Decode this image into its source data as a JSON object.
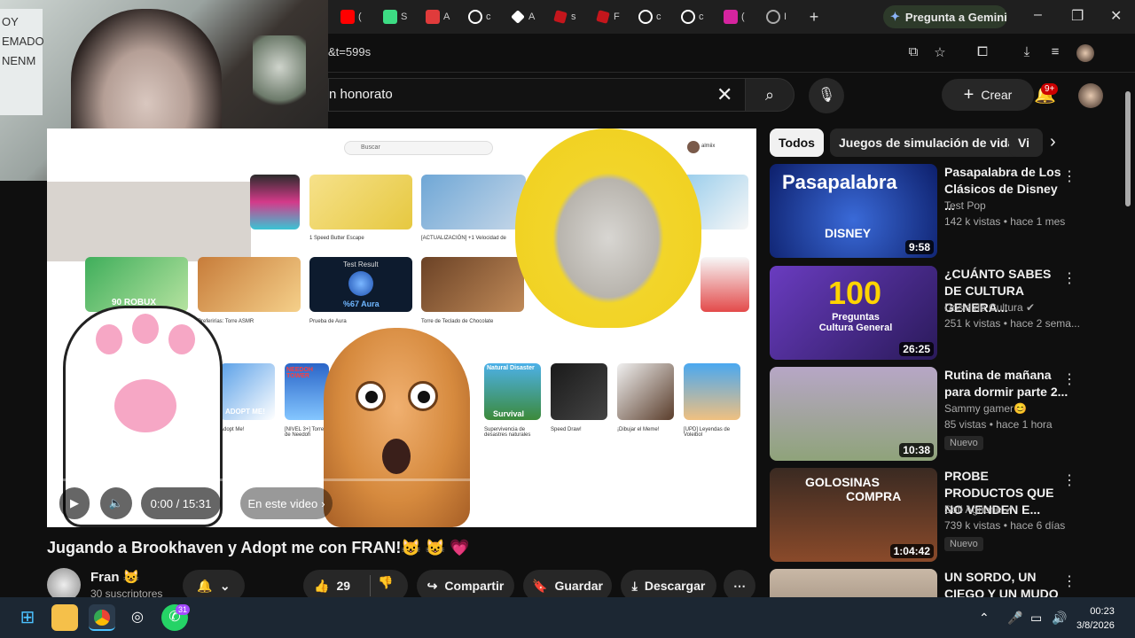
{
  "browser": {
    "url_fragment": "&t=599s",
    "tabs": [
      {
        "label": "(",
        "icon": "youtube-icon",
        "color": "#ff0000"
      },
      {
        "label": "S",
        "icon": "k-icon",
        "color": "#3ddc84"
      },
      {
        "label": "A",
        "icon": "pdf-icon",
        "color": "#e03b3b"
      },
      {
        "label": "c",
        "icon": "google-icon",
        "color": "#ffffff"
      },
      {
        "label": "A",
        "icon": "diamond-icon",
        "color": "#ffffff"
      },
      {
        "label": "s",
        "icon": "roblox-icon",
        "color": "#c4161c"
      },
      {
        "label": "F",
        "icon": "roblox-icon",
        "color": "#c4161c"
      },
      {
        "label": "c",
        "icon": "google-icon",
        "color": "#ffffff"
      },
      {
        "label": "c",
        "icon": "google-icon",
        "color": "#ffffff"
      },
      {
        "label": "(",
        "icon": "instagram-icon",
        "color": "#d6249f"
      },
      {
        "label": "I",
        "icon": "chrome-icon",
        "color": "#aaaaaa"
      }
    ],
    "gemini_label": "Pregunta a Gemini"
  },
  "webcam": {
    "paper_text": [
      "OY",
      "EMADO",
      "NENM"
    ]
  },
  "youtube": {
    "search_value": "n honorato",
    "create_label": "Crear",
    "notif_badge": "9+",
    "video": {
      "title": "Jugando a Brookhaven y Adopt me con FRAN!😺 😺 💗",
      "time": "0:00 / 15:31",
      "chapters_label": "En este video",
      "inner_search_placeholder": "Buscar",
      "inner_user": "almiix",
      "inner_captions": [
        "1 Speed Butter Escape",
        "[ACTUALIZACIÓN] +1 Velocidad de",
        "Preferirías: Torre ASMR",
        "Prueba de Aura",
        "Torre de Teclado de Chocolate",
        "Adopt Me!",
        "[NIVEL 3+] Torre de Needoh",
        "Supervivencia de desastres naturales",
        "Speed Draw!",
        "¡Dibujar el Meme!",
        "[UPD] Leyendas de Voleibol"
      ],
      "inner_labels": {
        "test_result": "Test Result",
        "aura": "%67 Aura",
        "adopt": "ADOPT ME!",
        "natural_disaster": "Natural Disaster",
        "survival": "Survival",
        "needoh": "NEEDOH TOWER",
        "robux": "90 ROBUX"
      }
    },
    "channel": {
      "name": "Fran 😺",
      "subscribers": "30 suscriptores"
    },
    "actions": {
      "likes": "29",
      "share": "Compartir",
      "save": "Guardar",
      "download": "Descargar"
    },
    "chips": [
      "Todos",
      "Juegos de simulación de vida",
      "Vi"
    ],
    "recommendations": [
      {
        "title": "Pasapalabra de Los Clásicos de Disney ...",
        "channel": "Test Pop",
        "meta": "142 k vistas • hace 1 mes",
        "duration": "9:58",
        "badge": "",
        "thumb_text": "Pasapalabra",
        "thumb_sub": "DISNEY",
        "color": "#1a3fa8"
      },
      {
        "title": "¿CUÁNTO SABES DE CULTURA GENERA...",
        "channel": "Dosis de Cultura ✔",
        "meta": "251 k vistas • hace 2 sema...",
        "duration": "26:25",
        "badge": "",
        "thumb_text": "100",
        "thumb_sub": "Preguntas Cultura General",
        "color": "#4b2a8c"
      },
      {
        "title": "Rutina de mañana para dormir parte 2...",
        "channel": "Sammy gamer😊",
        "meta": "85 vistas • hace 1 hora",
        "duration": "10:38",
        "badge": "Nuevo",
        "thumb_text": "",
        "thumb_sub": "",
        "color": "#8fa37a"
      },
      {
        "title": "PROBE PRODUCTOS QUE NO VENDEN E...",
        "channel": "Sofi Agnone ✔",
        "meta": "739 k vistas • hace 6 días",
        "duration": "1:04:42",
        "badge": "Nuevo",
        "thumb_text": "GOLOSINAS",
        "thumb_sub": "COMPRA",
        "color": "#5a3b2a"
      },
      {
        "title": "UN SORDO, UN CIEGO Y UN MUDO ...",
        "channel": "",
        "meta": "",
        "duration": "",
        "badge": "",
        "thumb_text": "",
        "thumb_sub": "",
        "color": "#7a6a5a"
      }
    ]
  },
  "taskbar": {
    "whatsapp_badge": "31",
    "time": "00:23",
    "date": "3/8/2026"
  }
}
